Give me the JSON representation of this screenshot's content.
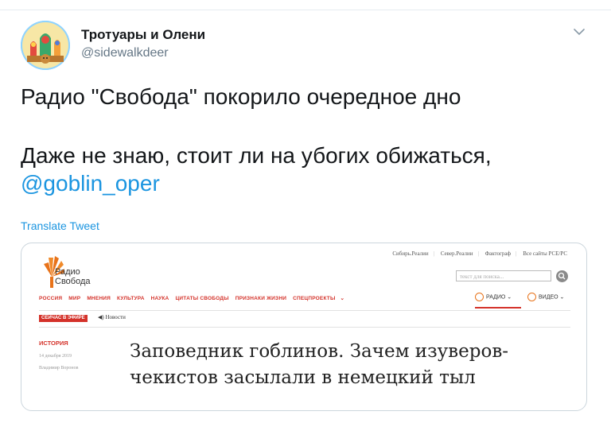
{
  "author": {
    "name": "Тротуары и Олени",
    "handle": "@sidewalkdeer"
  },
  "tweet": {
    "line1": "Радио \"Свобода\" покорило очередное дно",
    "line2": "Даже не знаю, стоит ли на убогих обижаться,",
    "mention": "@goblin_oper",
    "translate_label": "Translate Tweet"
  },
  "embedded": {
    "logo_line1": "Радио",
    "logo_line2": "Свобода",
    "top_links": [
      "Сибирь.Реалии",
      "Север.Реалии",
      "Фактограф",
      "Все сайты РСЕ/РС"
    ],
    "search_placeholder": "текст для поиска...",
    "nav": [
      "РОССИЯ",
      "МИР",
      "МНЕНИЯ",
      "КУЛЬТУРА",
      "НАУКА",
      "ЦИТАТЫ СВОБОДЫ",
      "ПРИЗНАКИ ЖИЗНИ",
      "СПЕЦПРОЕКТЫ"
    ],
    "radio_label": "РАДИО",
    "video_label": "ВИДЕО",
    "live_badge": "СЕЙЧАС В ЭФИРЕ",
    "live_news": "Новости",
    "rubric": "ИСТОРИЯ",
    "date": "14 декабря 2019",
    "author": "Владимир Воронов",
    "headline": "Заповедник гоблинов. Зачем изуверов-чекистов засылали в немецкий тыл"
  },
  "colors": {
    "link_blue": "#1b95e0",
    "rs_red": "#d4322a",
    "rs_orange": "#e8731a"
  }
}
